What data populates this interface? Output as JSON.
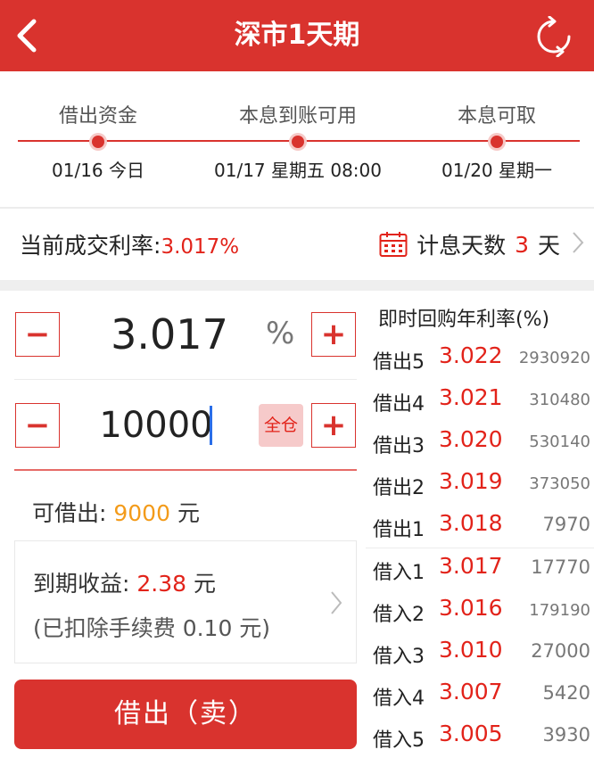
{
  "header": {
    "title": "深市1天期"
  },
  "timeline": {
    "steps": [
      {
        "label": "借出资金",
        "date": "01/16 今日"
      },
      {
        "label": "本息到账可用",
        "date": "01/17 星期五 08:00"
      },
      {
        "label": "本息可取",
        "date": "01/20 星期一"
      }
    ]
  },
  "rate_row": {
    "label": "当前成交利率:",
    "value": "3.017%",
    "days_label": "计息天数",
    "days_value": "3",
    "days_unit": "天"
  },
  "form": {
    "minus": "−",
    "plus": "+",
    "rate_value": "3.017",
    "rate_unit": "%",
    "amount_value": "10000",
    "all_in_label": "全仓",
    "avail_label": "可借出: ",
    "avail_value": "9000",
    "avail_unit": " 元",
    "profit_label": "到期收益: ",
    "profit_value": "2.38",
    "profit_unit": " 元",
    "fee_text": "(已扣除手续费 0.10 元)",
    "sell_button": "借出（卖）"
  },
  "quotes": {
    "title": "即时回购年利率(%)",
    "rows": [
      {
        "name": "借出5",
        "rate": "3.022",
        "volume": "2930920"
      },
      {
        "name": "借出4",
        "rate": "3.021",
        "volume": "310480"
      },
      {
        "name": "借出3",
        "rate": "3.020",
        "volume": "530140"
      },
      {
        "name": "借出2",
        "rate": "3.019",
        "volume": "373050"
      },
      {
        "name": "借出1",
        "rate": "3.018",
        "volume": "7970"
      },
      {
        "name": "借入1",
        "rate": "3.017",
        "volume": "17770"
      },
      {
        "name": "借入2",
        "rate": "3.016",
        "volume": "179190"
      },
      {
        "name": "借入3",
        "rate": "3.010",
        "volume": "27000"
      },
      {
        "name": "借入4",
        "rate": "3.007",
        "volume": "5420"
      },
      {
        "name": "借入5",
        "rate": "3.005",
        "volume": "3930"
      }
    ]
  },
  "colors": {
    "brand_red": "#d9332e",
    "rate_red": "#e2231a",
    "orange": "#f39b1a"
  }
}
